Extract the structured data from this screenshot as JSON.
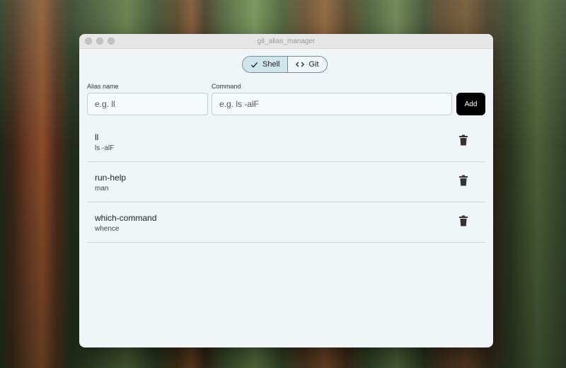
{
  "window": {
    "title": "git_alias_manager"
  },
  "toggle": {
    "options": [
      {
        "label": "Shell",
        "icon": "check-icon",
        "selected": true
      },
      {
        "label": "Git",
        "icon": "code-icon",
        "selected": false
      }
    ],
    "accent": "#cfe5ec"
  },
  "form": {
    "alias_label": "Alias name",
    "alias_placeholder": "e.g. ll",
    "command_label": "Command",
    "command_placeholder": "e.g. ls -alF",
    "add_label": "Add"
  },
  "aliases": [
    {
      "name": "ll",
      "command": "ls -alF"
    },
    {
      "name": "run-help",
      "command": "man"
    },
    {
      "name": "which-command",
      "command": "whence"
    }
  ]
}
